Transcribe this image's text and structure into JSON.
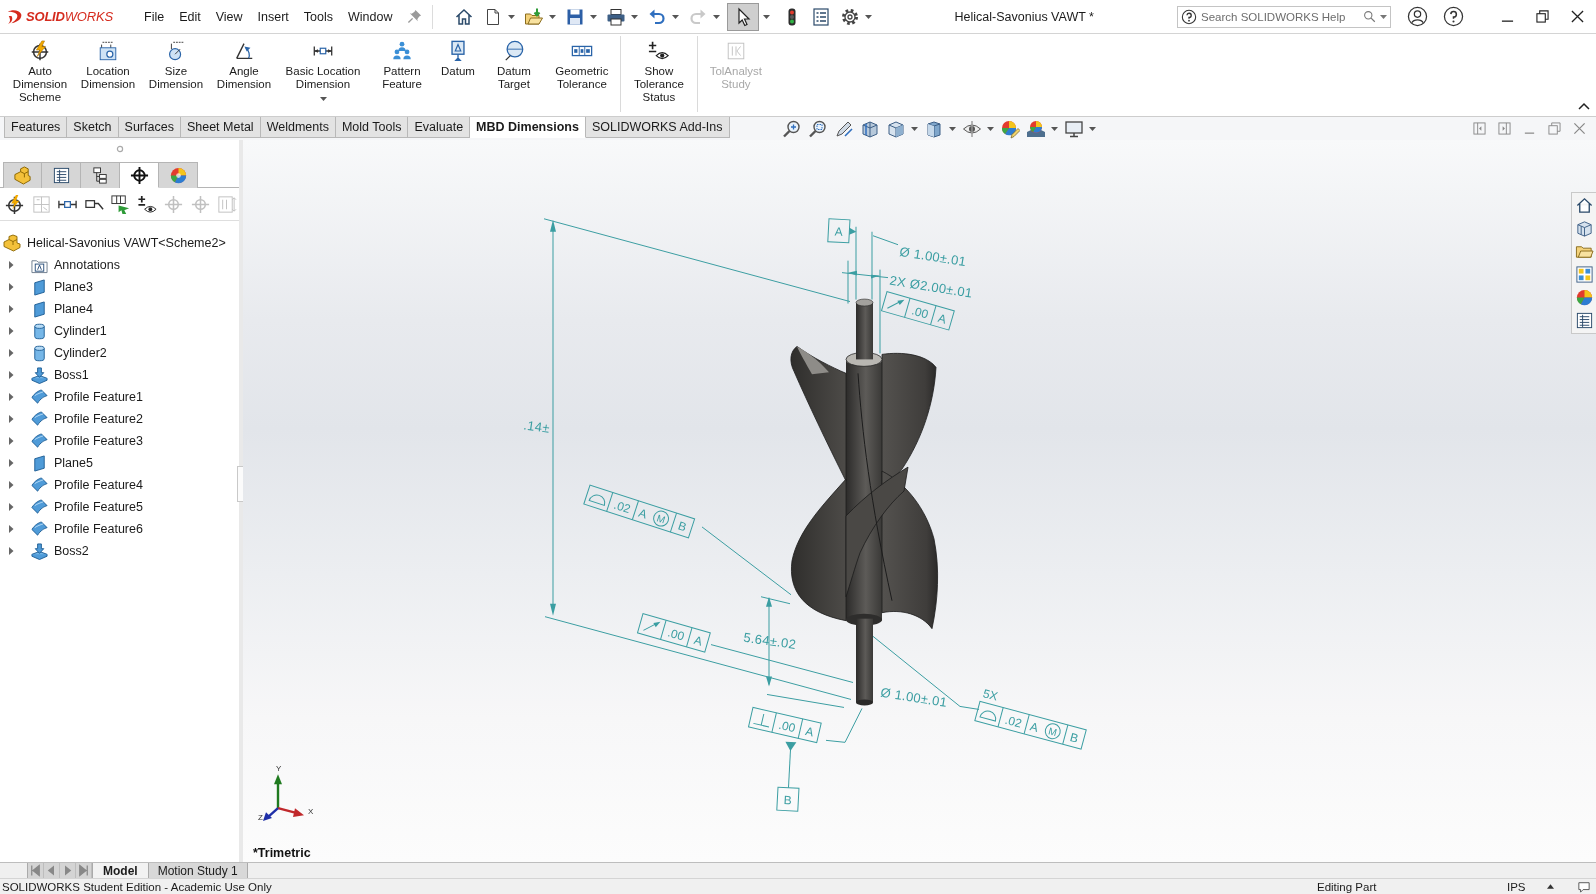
{
  "app": {
    "logo": "**SOLID**WORKS"
  },
  "menu": [
    "File",
    "Edit",
    "View",
    "Insert",
    "Tools",
    "Window"
  ],
  "quick_access": {
    "select_pressed": true,
    "redo_disabled": true
  },
  "document_title": "Helical-Savonius VAWT *",
  "help_search": {
    "placeholder": "Search SOLIDWORKS Help"
  },
  "ribbon": {
    "groups": [
      [
        {
          "label": "Auto Dimension Scheme",
          "disabled": false,
          "has_menu": false
        },
        {
          "label": "Location Dimension",
          "disabled": false,
          "has_menu": false
        },
        {
          "label": "Size Dimension",
          "disabled": false,
          "has_menu": false
        },
        {
          "label": "Angle Dimension",
          "disabled": false,
          "has_menu": false
        },
        {
          "label": "Basic Location Dimension",
          "disabled": false,
          "has_menu": true
        },
        {
          "label": "Pattern Feature",
          "disabled": false,
          "has_menu": false
        },
        {
          "label": "Datum",
          "disabled": false,
          "has_menu": false
        },
        {
          "label": "Datum Target",
          "disabled": false,
          "has_menu": false
        },
        {
          "label": "Geometric Tolerance",
          "disabled": false,
          "has_menu": false
        }
      ],
      [
        {
          "label": "Show Tolerance Status",
          "disabled": false,
          "has_menu": false
        }
      ],
      [
        {
          "label": "TolAnalyst Study",
          "disabled": true,
          "has_menu": false
        }
      ]
    ]
  },
  "command_tabs": [
    {
      "label": "Features",
      "selected": false
    },
    {
      "label": "Sketch",
      "selected": false
    },
    {
      "label": "Surfaces",
      "selected": false
    },
    {
      "label": "Sheet Metal",
      "selected": false
    },
    {
      "label": "Weldments",
      "selected": false
    },
    {
      "label": "Mold Tools",
      "selected": false
    },
    {
      "label": "Evaluate",
      "selected": false
    },
    {
      "label": "MBD Dimensions",
      "selected": true
    },
    {
      "label": "SOLIDWORKS Add-Ins",
      "selected": false
    }
  ],
  "feature_manager": {
    "tabs": [
      {
        "selected": false
      },
      {
        "selected": false
      },
      {
        "selected": false
      },
      {
        "selected": true
      },
      {
        "selected": false
      }
    ],
    "tools": [
      {
        "disabled": false
      },
      {
        "disabled": true
      },
      {
        "disabled": false
      },
      {
        "disabled": false
      },
      {
        "disabled": false
      },
      {
        "disabled": false
      },
      {
        "disabled": true
      },
      {
        "disabled": true
      },
      {
        "disabled": true
      }
    ],
    "tree": {
      "kind": "part",
      "label": "Helical-Savonius VAWT<Scheme2>",
      "children": [
        {
          "kind": "annotations",
          "label": "Annotations",
          "expanded": false
        },
        {
          "kind": "plane",
          "label": "Plane3",
          "expanded": false
        },
        {
          "kind": "plane",
          "label": "Plane4",
          "expanded": false
        },
        {
          "kind": "cylinder",
          "label": "Cylinder1",
          "expanded": false
        },
        {
          "kind": "cylinder",
          "label": "Cylinder2",
          "expanded": false
        },
        {
          "kind": "boss",
          "label": "Boss1",
          "expanded": false
        },
        {
          "kind": "profile",
          "label": "Profile Feature1",
          "expanded": false
        },
        {
          "kind": "profile",
          "label": "Profile Feature2",
          "expanded": false
        },
        {
          "kind": "profile",
          "label": "Profile Feature3",
          "expanded": false
        },
        {
          "kind": "plane",
          "label": "Plane5",
          "expanded": false
        },
        {
          "kind": "profile",
          "label": "Profile Feature4",
          "expanded": false
        },
        {
          "kind": "profile",
          "label": "Profile Feature5",
          "expanded": false
        },
        {
          "kind": "profile",
          "label": "Profile Feature6",
          "expanded": false
        },
        {
          "kind": "boss",
          "label": "Boss2",
          "expanded": false
        }
      ]
    }
  },
  "viewport": {
    "annotations": [
      {
        "kind": "datum",
        "label": "A"
      },
      {
        "kind": "dimension",
        "text": "Ø 1.00±.01"
      },
      {
        "kind": "dimension",
        "text": "2X Ø2.00±.01"
      },
      {
        "kind": "runout",
        "cells": [
          {
            "text": ".00"
          },
          {
            "text": "A"
          }
        ]
      },
      {
        "kind": "dimension",
        "text": ".14±"
      },
      {
        "kind": "profile",
        "cells": [
          {
            "text": ".02"
          },
          {
            "text": "A",
            "modifier": "M"
          },
          {
            "text": "B"
          }
        ]
      },
      {
        "kind": "runout",
        "cells": [
          {
            "text": ".00"
          },
          {
            "text": "A"
          }
        ]
      },
      {
        "kind": "dimension",
        "text": "5.64±.02"
      },
      {
        "kind": "dimension",
        "text": "Ø 1.00±.01"
      },
      {
        "kind": "perpendicularity",
        "cells": [
          {
            "text": ".00"
          },
          {
            "text": "A"
          }
        ]
      },
      {
        "kind": "profile",
        "prefix": "5X",
        "cells": [
          {
            "text": ".02"
          },
          {
            "text": "A",
            "modifier": "M"
          },
          {
            "text": "B"
          }
        ]
      },
      {
        "kind": "datum",
        "label": "B"
      }
    ],
    "triad": {
      "y": "Y",
      "x": "X",
      "z": "Z"
    },
    "view_name": "*Trimetric"
  },
  "model_tabs": [
    {
      "label": "Model",
      "selected": true
    },
    {
      "label": "Motion Study 1",
      "selected": false
    }
  ],
  "status_bar": {
    "message": "SOLIDWORKS Student Edition - Academic Use Only",
    "mode": "Editing Part",
    "units": "IPS"
  }
}
